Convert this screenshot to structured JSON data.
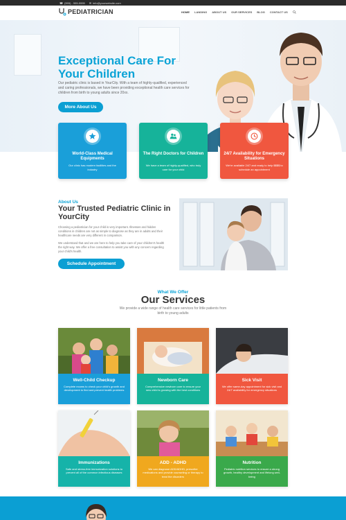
{
  "topbar": {
    "phone": "(555) - 555-5555",
    "email": "info@yourwebsite.com"
  },
  "header": {
    "logo_text": "PEDIATRICIAN",
    "nav": [
      "HOME",
      "LANDING",
      "ABOUT US",
      "OUR SERVICES",
      "BLOG",
      "CONTACT US"
    ]
  },
  "hero": {
    "title": "Exceptional Care For Your Children",
    "text": "Our pediatric clinic is based in YourCity. With a team of highly-qualified, experienced and caring professionals, we have been providing exceptional health care services for children from birth to young adults since 20xx.",
    "button": "More About Us"
  },
  "features": [
    {
      "icon": "star-icon",
      "title": "World-Class Medical Equipments",
      "text": "Our clinic has modern facilities and the industry",
      "color": "#1a9fd9"
    },
    {
      "icon": "people-icon",
      "title": "The Right Doctors for Children",
      "text": "We have a team of highly-qualified, who truly care for your child",
      "color": "#16b39a"
    },
    {
      "icon": "clock-icon",
      "title": "24/7 Availability for Emergency Situations",
      "text": "We're available 24/7 and ready to help $$$$ to schedule an appointment",
      "color": "#f0573f"
    }
  ],
  "about": {
    "kicker": "About Us",
    "title": "Your Trusted Pediatric Clinic in YourCity",
    "p1": "Choosing a pediatrician for your child is very important. Illnesses and hidden conditions in children are not as simple to diagnose as they are in adults and their healthcare needs are very different in comparison.",
    "p2": "We understand that and we are here to help you take care of your children's health the right way. We offer a free consultation to assist you with any concern regarding your child's health.",
    "button": "Schedule Appointment"
  },
  "services": {
    "kicker": "What We Offer",
    "title": "Our Services",
    "subtitle": "We provide a wide range of health care services for little patients from birth to young adults",
    "items": [
      {
        "title": "Well-Child Checkup",
        "text": "Complete exams to check your child's growth and development to find and prevent health problems",
        "color": "#1a9fd9"
      },
      {
        "title": "Newborn Care",
        "text": "Comprehensive newborn care to ensure your new child is growing with the best conditions",
        "color": "#16b39a"
      },
      {
        "title": "Sick Visit",
        "text": "We offer same-day appointment for sick visit and 24/7 availability for emergency situations",
        "color": "#f0573f"
      },
      {
        "title": "Immunizations",
        "text": "Safe and stress-free immunization solutions to prevent all of the common infectious diseases",
        "color": "#16b3a9"
      },
      {
        "title": "ADD - ADHD",
        "text": "We can diagnose ADD/ADHD, prescribe medications and provide counseling or therapy to treat the disorders",
        "color": "#f0a81e"
      },
      {
        "title": "Nutrition",
        "text": "Pediatric nutrition services to ensure a strong growth, healthy development and lifelong well-being",
        "color": "#3aa94b"
      }
    ]
  }
}
